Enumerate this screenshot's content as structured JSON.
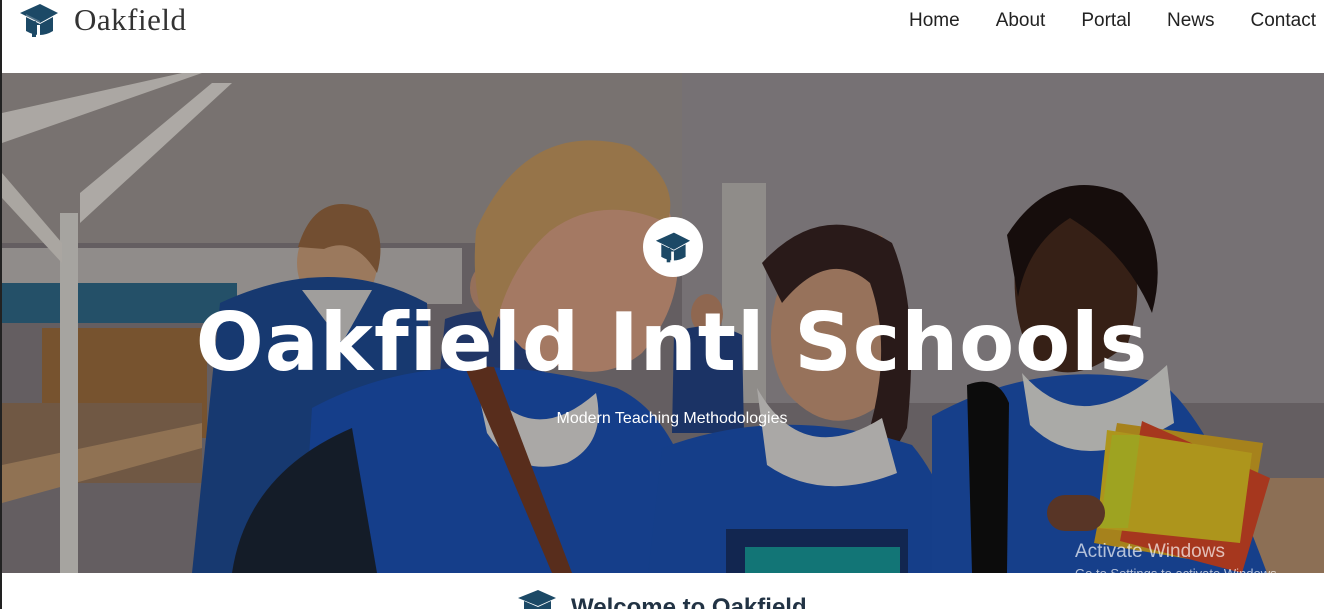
{
  "header": {
    "brand": {
      "name": "Oakfield",
      "icon": "graduation-cap-icon",
      "brand_color": "#1c4966"
    },
    "nav": [
      {
        "label": "Home"
      },
      {
        "label": "About"
      },
      {
        "label": "Portal"
      },
      {
        "label": "News"
      },
      {
        "label": "Contact"
      }
    ]
  },
  "hero": {
    "icon": "graduation-cap-icon",
    "title": "Oakfield Intl Schools",
    "subtitle": "Modern Teaching Methodologies",
    "photo": "students-in-school-hallway"
  },
  "welcome": {
    "icon": "graduation-cap-icon",
    "title": "Welcome to Oakfield"
  },
  "watermark": {
    "title": "Activate Windows",
    "subtitle": "Go to Settings to activate Windows."
  },
  "colors": {
    "brand": "#1c4966",
    "hero_text": "#ffffff",
    "navbar_background": "#ffffff"
  }
}
